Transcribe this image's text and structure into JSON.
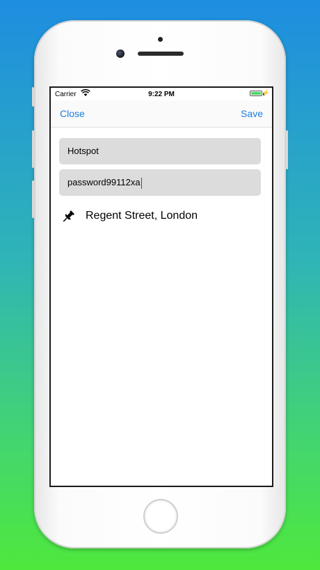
{
  "status_bar": {
    "carrier": "Carrier",
    "time": "9:22 PM",
    "battery_color": "#4cd964"
  },
  "nav": {
    "close_label": "Close",
    "save_label": "Save",
    "accent_color": "#1a7fe0"
  },
  "form": {
    "network_name": "Hotspot",
    "password": "password99112xa"
  },
  "location": {
    "icon": "pushpin-icon",
    "label": "Regent Street, London"
  }
}
